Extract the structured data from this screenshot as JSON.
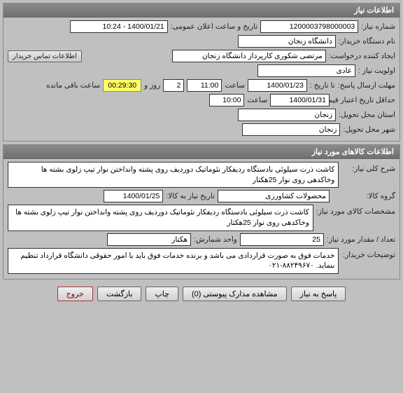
{
  "panel1": {
    "title": "اطلاعات نیاز",
    "need_no_label": "شماره نیاز:",
    "need_no": "1200003798000003",
    "pub_datetime_label": "تاریخ و ساعت اعلان عمومی:",
    "pub_datetime": "1400/01/21 - 10:24",
    "buyer_org_label": "نام دستگاه خریدار:",
    "buyer_org": "دانشگاه زنجان",
    "creator_label": "ایجاد کننده درخواست:",
    "creator": "مرتضی شکوری کارپرداز دانشگاه زنجان",
    "contact_btn": "اطلاعات تماس خریدار",
    "priority_label": "اولویت نیاز :",
    "priority": "عادی",
    "deadline_label": "مهلت ارسال پاسخ:",
    "until_label": "تا تاریخ :",
    "until_date": "1400/01/23",
    "time_label": "ساعت",
    "until_time": "11:00",
    "days_val": "2",
    "days_label": "روز و",
    "remain_time": "00:29:30",
    "remain_label": "ساعت باقی مانده",
    "min_valid_label": "حداقل تاریخ اعتبار قیمت:",
    "min_valid_date": "1400/01/31",
    "min_valid_time": "10:00",
    "province_label": "استان محل تحویل:",
    "province": "زنجان",
    "city_label": "شهر محل تحویل:",
    "city": "زنجان"
  },
  "panel2": {
    "title": "اطلاعات کالاهای مورد نیاز",
    "desc_label": "شرح کلی نیاز:",
    "desc": "کاشت ذرت سیلوئی بادستگاه ردیفکار نئوماتیک دوردیف روی پشته وانداختن نوار تیپ زلوی بشته ها وخاکدهی روی نوار 25هکتار",
    "group_label": "گروه کالا:",
    "group": "محصولات کشاورزی",
    "delivery_label": "تاریخ نیاز به کالا:",
    "delivery": "1400/01/25",
    "spec_label": "مشخصات کالای مورد نیاز:",
    "spec": "کاشت ذرت سیلوئی بادستگاه ردیفکار نئوماتیک دوردیف روی پشته وانداختن نوار تیپ زلوی بشته ها وخاکدهی روی نوار 25هکتار",
    "qty_label": "تعداد / مقدار مورد نیاز:",
    "qty": "25",
    "unit_label": "واحد شمارش:",
    "unit": "هکتار",
    "notes_label": "توضیحات خریدار:",
    "notes": "خدمات فوق به صورت قراردادی می باشد و برنده خدمات فوق باید با امور حقوقی دانشگاه قرارداد تنظیم بنماید.                                                                           ۸۸۲۴۹۶۷۰-۰۲۱"
  },
  "footer": {
    "respond": "پاسخ به نیاز",
    "attach": "مشاهده مدارک پیوستی (0)",
    "print": "چاپ",
    "back": "بازگشت",
    "exit": "خروج"
  }
}
